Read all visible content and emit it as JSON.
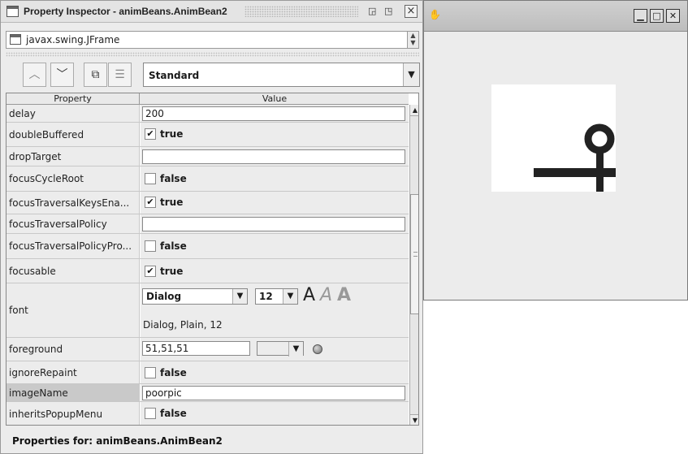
{
  "inspector": {
    "title": "Property Inspector - animBeans.AnimBean2",
    "close_label": "⊠",
    "class_name": "javax.swing.JFrame",
    "view_mode": "Standard",
    "table_headers": {
      "property": "Property",
      "value": "Value"
    },
    "rows": [
      {
        "name": "delay",
        "type": "text",
        "value": "200"
      },
      {
        "name": "doubleBuffered",
        "type": "bool",
        "checked": true,
        "value": "true"
      },
      {
        "name": "dropTarget",
        "type": "text",
        "value": ""
      },
      {
        "name": "focusCycleRoot",
        "type": "bool",
        "checked": false,
        "value": "false"
      },
      {
        "name": "focusTraversalKeysEna...",
        "type": "bool",
        "checked": true,
        "value": "true"
      },
      {
        "name": "focusTraversalPolicy",
        "type": "text",
        "value": ""
      },
      {
        "name": "focusTraversalPolicyPro...",
        "type": "bool",
        "checked": false,
        "value": "false"
      },
      {
        "name": "focusable",
        "type": "bool",
        "checked": true,
        "value": "true"
      },
      {
        "name": "font",
        "type": "font",
        "family": "Dialog",
        "size": "12",
        "description": "Dialog, Plain, 12"
      },
      {
        "name": "foreground",
        "type": "color",
        "value": "51,51,51"
      },
      {
        "name": "ignoreRepaint",
        "type": "bool",
        "checked": false,
        "value": "false"
      },
      {
        "name": "imageName",
        "type": "text",
        "value": "poorpic",
        "selected": true
      },
      {
        "name": "inheritsPopupMenu",
        "type": "bool",
        "checked": false,
        "value": "false"
      }
    ],
    "status": "Properties for:  animBeans.AnimBean2"
  },
  "icons": {
    "title": "frame-icon",
    "move_up": "chevron-up-icon",
    "move_down": "chevron-down-icon",
    "copy": "copy-icon",
    "list": "list-icon"
  },
  "colors": {
    "foreground_swatch": "#333333",
    "selected_row": "#c9c9c9",
    "panel_bg": "#ececec"
  }
}
